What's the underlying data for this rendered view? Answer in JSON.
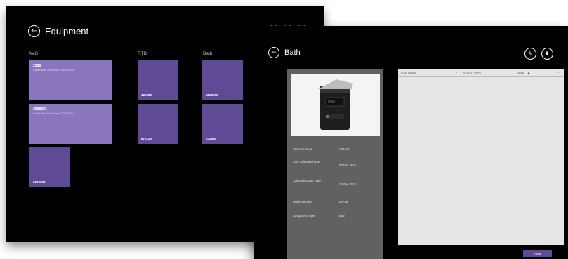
{
  "equipment_screen": {
    "title": "Equipment",
    "groups": [
      {
        "label": "AVG"
      },
      {
        "label": "RTD"
      },
      {
        "label": "Bath"
      }
    ],
    "tiles": [
      {
        "name": "2586",
        "sub": "Calibration Due Date: 06/25/2014",
        "label": ""
      },
      {
        "name": "2588892",
        "sub": "Calibration Due Date: 07/05/2014",
        "label": ""
      },
      {
        "name": "",
        "sub": "",
        "label": "2009682"
      },
      {
        "name": "",
        "sub": "",
        "label": "125980"
      },
      {
        "name": "",
        "sub": "",
        "label": "875120"
      },
      {
        "name": "",
        "sub": "",
        "label": "3220910"
      },
      {
        "name": "",
        "sub": "",
        "label": "232888"
      }
    ]
  },
  "bath_screen": {
    "title": "Bath",
    "details": [
      {
        "key": "Serial Number",
        "value": "123456"
      },
      {
        "key": "Last Calibrated Date",
        "value": "07 Mar 2013"
      },
      {
        "key": "Calibration Due Date",
        "value": "11 Sep 2013"
      },
      {
        "key": "Model Number",
        "value": "DK-3B"
      },
      {
        "key": "Equipment Type",
        "value": "Bath"
      }
    ],
    "table": {
      "columns": [
        "FILE NAME",
        "STUDY TYPE",
        "DATE"
      ],
      "sort_indicator": "▲"
    },
    "print_label": "Print"
  },
  "colors": {
    "tile": "#5f4a95",
    "tile_light": "#8a76bc",
    "background": "#000000",
    "panel": "#5f625f"
  },
  "icons": [
    "back-arrow-icon",
    "edit-icon",
    "delete-icon",
    "dropdown-arrow-icon",
    "sort-ascending-icon"
  ]
}
